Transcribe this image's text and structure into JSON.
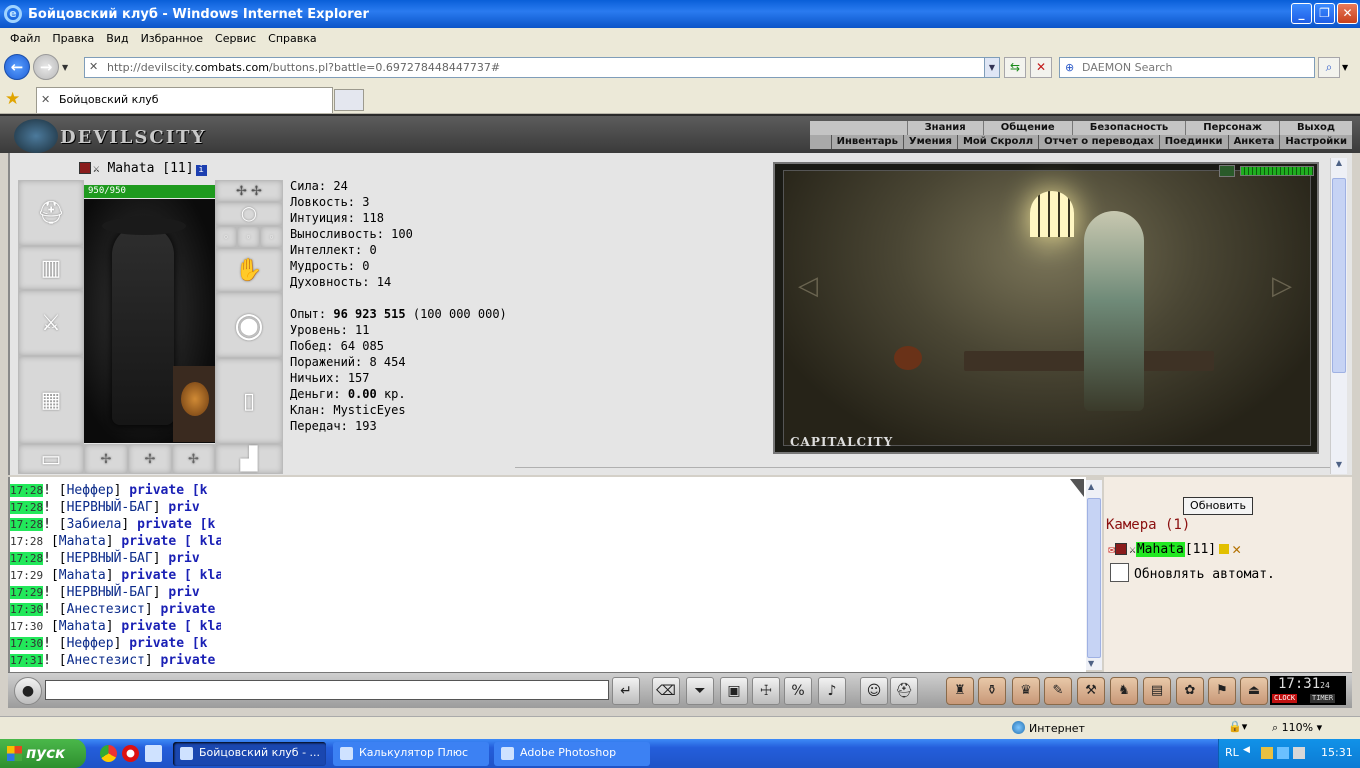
{
  "window": {
    "title": "Бойцовский клуб - Windows Internet Explorer"
  },
  "menu": [
    "Файл",
    "Правка",
    "Вид",
    "Избранное",
    "Сервис",
    "Справка"
  ],
  "address": {
    "url_prefix": "http://devilscity.",
    "url_domain": "combats.com",
    "url_suffix": "/buttons.pl?battle=0.697278448447737#",
    "search_placeholder": "DAEMON Search"
  },
  "tab": {
    "title": "Бойцовский клуб"
  },
  "game": {
    "logo": "DEVILSCITY",
    "nav_top": [
      "Знания",
      "Общение",
      "Безопасность",
      "Персонаж",
      "Выход"
    ],
    "nav_bottom": [
      "Инвентарь",
      "Умения",
      "Мой Скролл",
      "Отчет о переводах",
      "Поединки",
      "Анкета",
      "Настройки"
    ],
    "character": {
      "name": "Mahata",
      "level": "[11]",
      "info_icon": "i",
      "hp": "950/950"
    },
    "stats": [
      {
        "label": "Сила:",
        "value": "24"
      },
      {
        "label": "Ловкость:",
        "value": "3"
      },
      {
        "label": "Интуиция:",
        "value": "118"
      },
      {
        "label": "Выносливость:",
        "value": "100"
      },
      {
        "label": "Интеллект:",
        "value": "0"
      },
      {
        "label": "Мудрость:",
        "value": "0"
      },
      {
        "label": "Духовность:",
        "value": "14"
      }
    ],
    "exp": {
      "label": "Опыт:",
      "value": "96 923 515",
      "next": "(100 000 000)"
    },
    "info": [
      {
        "label": "Уровень:",
        "value": "11"
      },
      {
        "label": "Побед:",
        "value": "64 085"
      },
      {
        "label": "Поражений:",
        "value": "8 454"
      },
      {
        "label": "Ничьих:",
        "value": "157"
      }
    ],
    "money": {
      "label": "Деньги:",
      "value": "0.00",
      "unit": "кр."
    },
    "clan": {
      "label": "Клан:",
      "value": "MysticEyes"
    },
    "transfers": {
      "label": "Передач:",
      "value": "193"
    },
    "scene_label": "CAPITALCITY"
  },
  "chat": [
    {
      "time": "17:28",
      "hl": true,
      "pre": "! ",
      "nick": "Неффер",
      "pv": "private [k"
    },
    {
      "time": "17:28",
      "hl": true,
      "pre": "! ",
      "nick": "НЕРВНЫЙ-БАГ",
      "pv": "priv"
    },
    {
      "time": "17:28",
      "hl": true,
      "pre": "! ",
      "nick": "Забиела",
      "pv": "private [k"
    },
    {
      "time": "17:28",
      "hl": false,
      "pre": " ",
      "nick": "Mahata",
      "pv": "private [ kla"
    },
    {
      "time": "17:28",
      "hl": true,
      "pre": "! ",
      "nick": "НЕРВНЫЙ-БАГ",
      "pv": "priv"
    },
    {
      "time": "17:29",
      "hl": false,
      "pre": " ",
      "nick": "Mahata",
      "pv": "private [ kla"
    },
    {
      "time": "17:29",
      "hl": true,
      "pre": "! ",
      "nick": "НЕРВНЫЙ-БАГ",
      "pv": "priv"
    },
    {
      "time": "17:30",
      "hl": true,
      "pre": "! ",
      "nick": "Анестезист",
      "pv": "private"
    },
    {
      "time": "17:30",
      "hl": false,
      "pre": " ",
      "nick": "Mahata",
      "pv": "private [ kla"
    },
    {
      "time": "17:30",
      "hl": true,
      "pre": "! ",
      "nick": "Неффер",
      "pv": "private [k"
    },
    {
      "time": "17:31",
      "hl": true,
      "pre": "! ",
      "nick": "Анестезист",
      "pv": "private"
    }
  ],
  "room_panel": {
    "refresh": "Обновить",
    "room": "Камера (1)",
    "user": "Mahata",
    "user_level": "[11]",
    "auto_label": "Обновлять автомат."
  },
  "clock": {
    "time": "17:31",
    "seconds": "24",
    "clock_label": "CLOCK",
    "timer_label": "TIMER"
  },
  "status": {
    "zone": "Интернет",
    "zoom": "110%"
  },
  "taskbar": {
    "start": "пуск",
    "tasks": [
      "Бойцовский клуб - ...",
      "Калькулятор Плюс",
      "Adobe Photoshop"
    ],
    "lang": "RL",
    "time": "15:31"
  }
}
